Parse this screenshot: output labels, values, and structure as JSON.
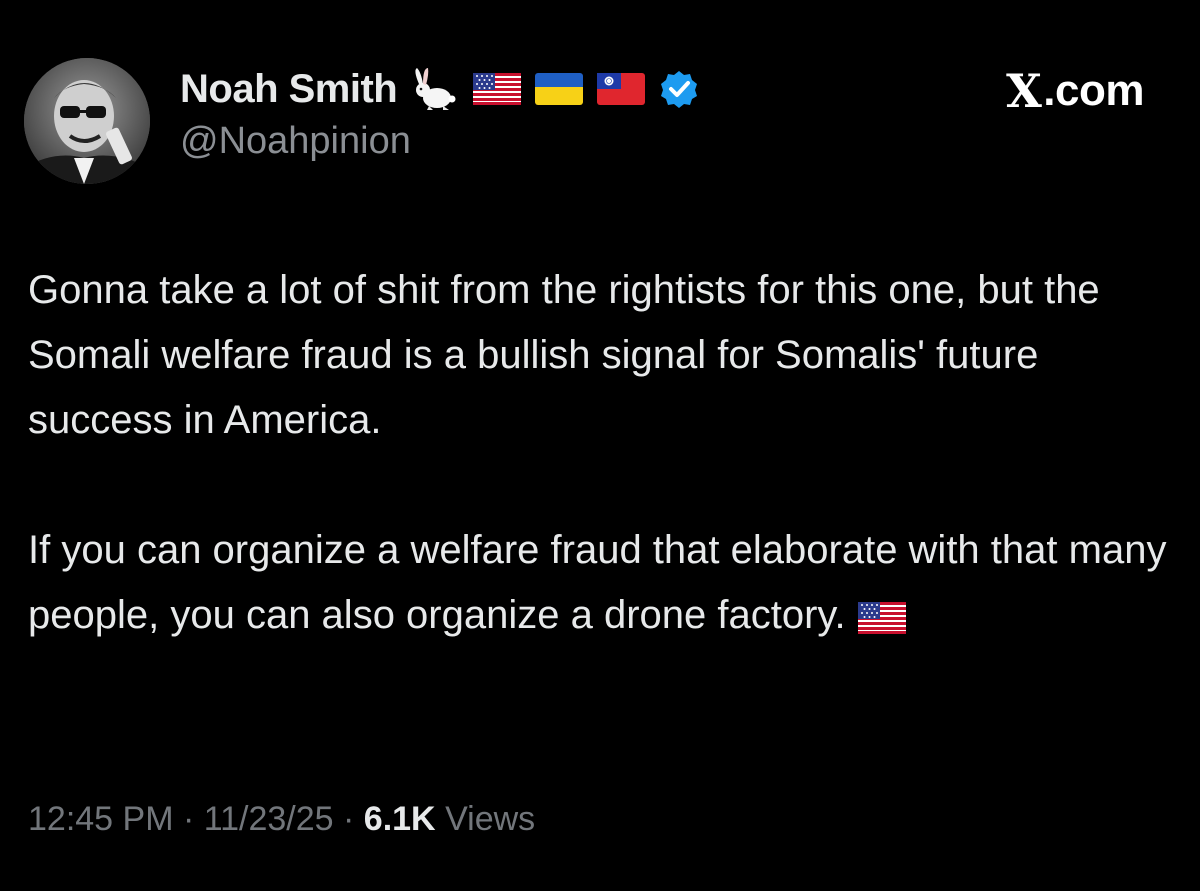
{
  "user": {
    "display_name": "Noah Smith",
    "handle": "@Noahpinion",
    "badges": [
      "rabbit-emoji",
      "us-flag-icon",
      "ukraine-flag-icon",
      "taiwan-flag-icon",
      "verified-badge-icon"
    ]
  },
  "brand": {
    "text": ".com",
    "logo_letter": "X"
  },
  "tweet": {
    "paragraph_1": "Gonna take a lot of shit from the rightists for this one, but the Somali welfare fraud is a bullish signal for Somalis' future success in America.",
    "paragraph_2": "If you can organize a welfare fraud that elaborate with that many people, you can also organize a drone factory.",
    "trailing_emoji": "us-flag-icon"
  },
  "meta": {
    "time": "12:45 PM",
    "separator": " · ",
    "date": "11/23/25",
    "views_count": "6.1K",
    "views_label": "Views"
  },
  "colors": {
    "background": "#000000",
    "text": "#e7e9ea",
    "muted": "#8b8f94",
    "verified": "#1d9bf0"
  }
}
